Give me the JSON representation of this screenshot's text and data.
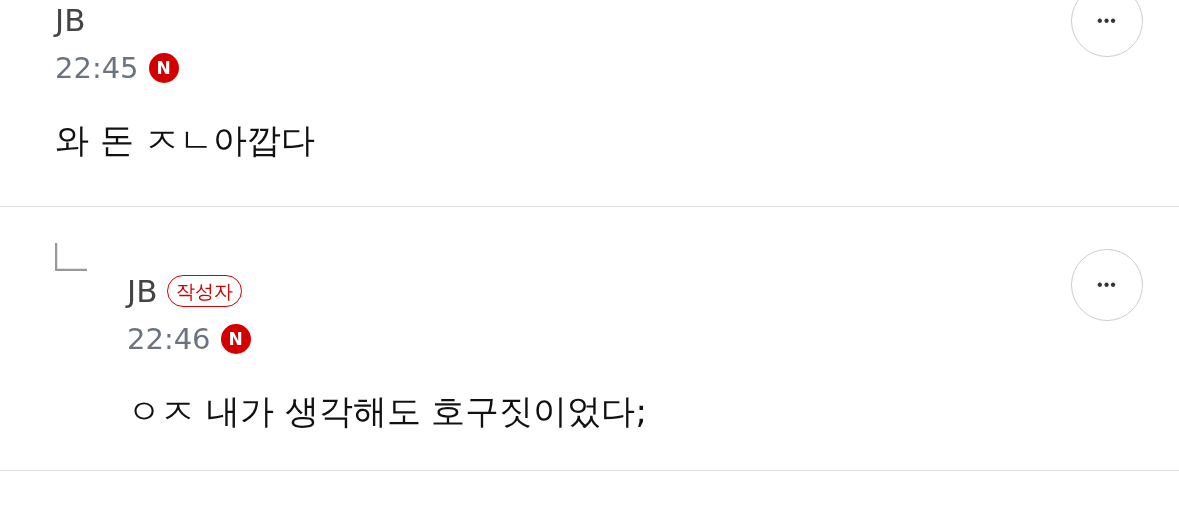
{
  "comments": [
    {
      "author": "JB",
      "time": "22:45",
      "source_badge": "N",
      "text": "와 돈 ㅈㄴ아깝다",
      "is_reply": false,
      "more_button": "•••"
    },
    {
      "author": "JB",
      "author_badge": "작성자",
      "time": "22:46",
      "source_badge": "N",
      "text": "ㅇㅈ 내가 생각해도 호구짓이었다;",
      "is_reply": true,
      "more_button": "•••"
    }
  ]
}
